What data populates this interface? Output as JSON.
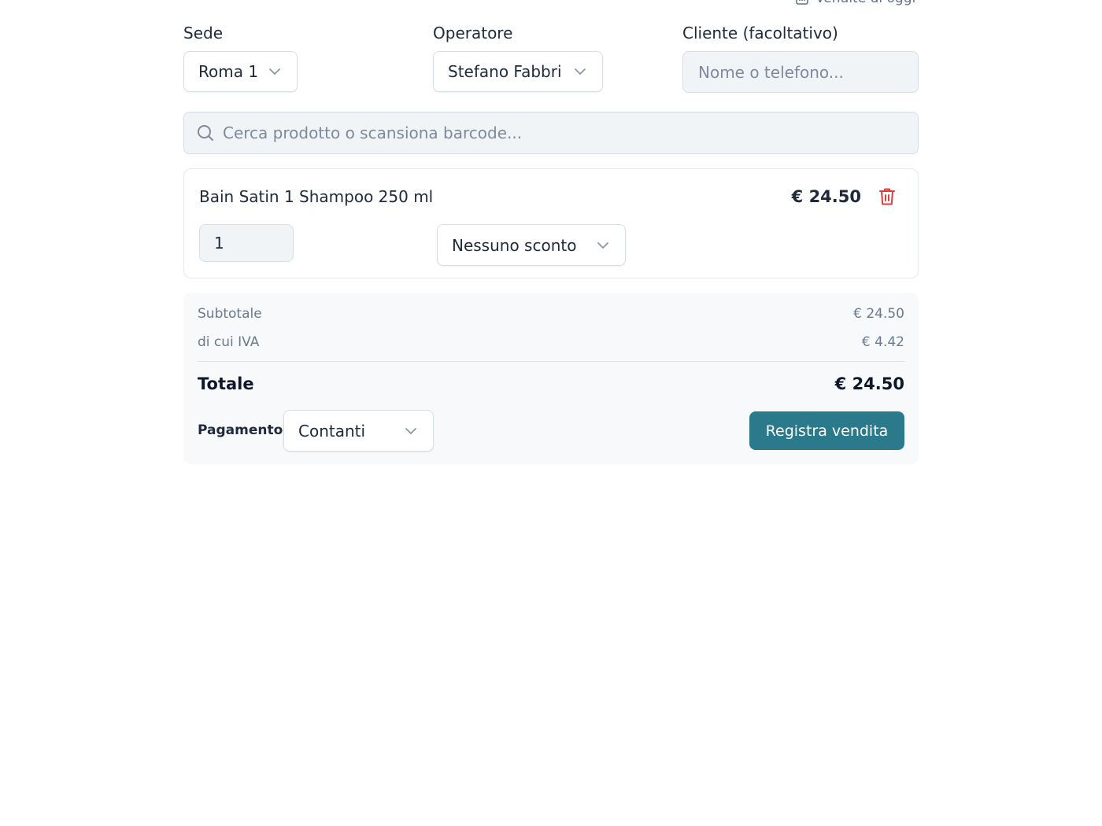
{
  "header": {
    "link_label": "Vendite di oggi",
    "link_icon": "chart-icon"
  },
  "form": {
    "sede_label": "Sede",
    "sede_value": "Roma 1",
    "operatore_label": "Operatore",
    "operatore_value": "Stefano Fabbri",
    "cliente_label": "Cliente (facoltativo)",
    "cliente_value": "",
    "cliente_placeholder": "Nome o telefono..."
  },
  "search": {
    "value": "",
    "placeholder": "Cerca prodotto o scansiona barcode...",
    "icon": "search-icon"
  },
  "cart": {
    "items": [
      {
        "name": "Bain Satin 1 Shampoo 250 ml",
        "price": "€ 24.50",
        "quantity": "1",
        "discount": "Nessuno sconto",
        "delete_icon": "trash-icon"
      }
    ]
  },
  "summary": {
    "subtotal_label": "Subtotale",
    "subtotal_value": "€ 24.50",
    "iva_label": "di cui IVA",
    "iva_value": "€ 4.42",
    "total_label": "Totale",
    "total_value": "€ 24.50",
    "payment_label": "Pagamento",
    "payment_value": "Contanti",
    "submit_label": "Registra vendita"
  },
  "colors": {
    "accent": "#2b7a8c",
    "danger": "#e23b3b",
    "muted_text": "#6b7a8d",
    "input_bg": "#f1f4f7",
    "summary_bg": "#f7f9fb"
  }
}
